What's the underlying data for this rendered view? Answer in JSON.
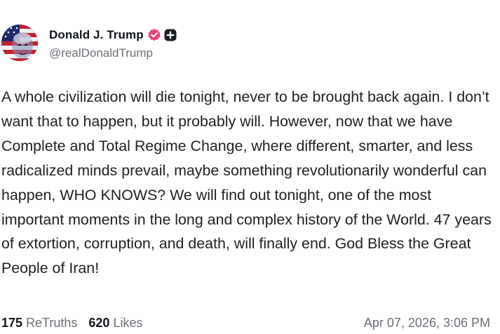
{
  "user": {
    "display_name": "Donald J. Trump",
    "handle": "@realDonaldTrump",
    "verified_badge_icon": "verified-check-icon",
    "plus_badge_icon": "plus-icon",
    "verified_color": "#e0457b"
  },
  "post": {
    "text": "A whole civilization will die tonight, never to be brought back again. I don’t want that to happen, but it probably will. However, now that we have Complete and Total Regime Change, where different, smarter, and less radicalized minds prevail, maybe something revolutionarily wonderful can happen, WHO KNOWS? We will find out tonight, one of the most important moments in the long and complex history of the World. 47 years of extortion, corruption, and death, will finally end. God Bless the Great People of Iran!"
  },
  "stats": {
    "retruths_count": "175",
    "retruths_label": "ReTruths",
    "likes_count": "620",
    "likes_label": "Likes"
  },
  "timestamp": "Apr 07, 2026, 3:06 PM"
}
